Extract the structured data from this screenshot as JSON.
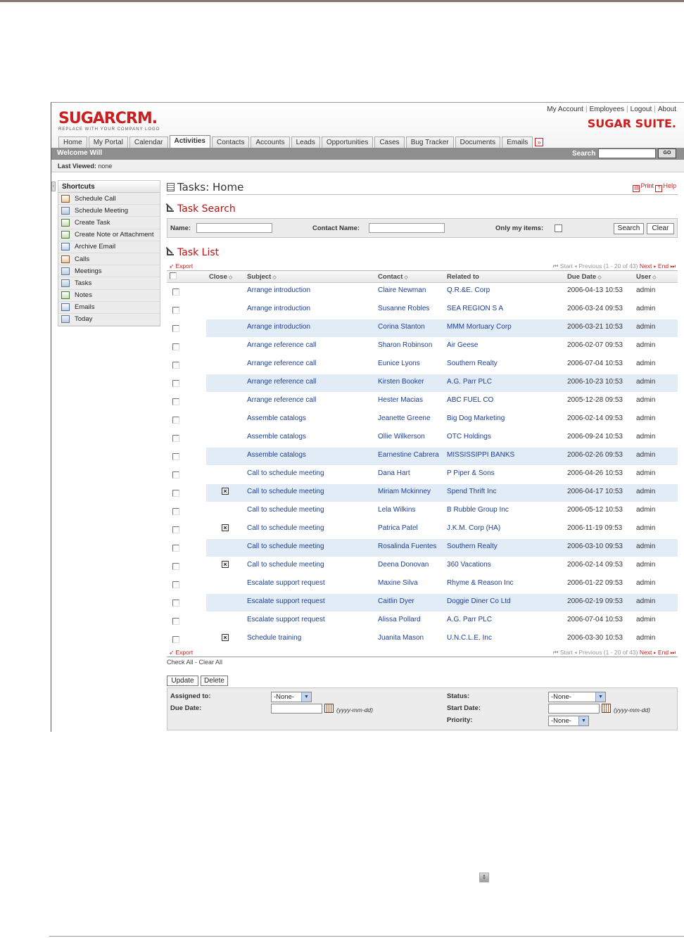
{
  "header": {
    "logo_text": "SUGARCRM.",
    "logo_tagline": "REPLACE WITH YOUR COMPANY LOGO",
    "suite_name": "SUGAR SUITE.",
    "top_links": [
      "My Account",
      "Employees",
      "Logout",
      "About"
    ],
    "tabs": [
      "Home",
      "My Portal",
      "Calendar",
      "Activities",
      "Contacts",
      "Accounts",
      "Leads",
      "Opportunities",
      "Cases",
      "Bug Tracker",
      "Documents",
      "Emails"
    ],
    "active_tab": "Activities",
    "more_tabs_glyph": "»"
  },
  "welcome_bar": {
    "welcome_text": "Welcome Will",
    "search_label": "Search",
    "search_value": "",
    "go_label": "GO"
  },
  "last_viewed": {
    "label": "Last Viewed:",
    "value": "none"
  },
  "shortcuts": {
    "title": "Shortcuts",
    "items": [
      {
        "label": "Schedule Call",
        "icon": "phone-calendar-icon"
      },
      {
        "label": "Schedule Meeting",
        "icon": "meeting-icon"
      },
      {
        "label": "Create Task",
        "icon": "task-icon"
      },
      {
        "label": "Create Note or Attachment",
        "icon": "note-icon"
      },
      {
        "label": "Archive Email",
        "icon": "email-icon"
      },
      {
        "label": "Calls",
        "icon": "calls-icon"
      },
      {
        "label": "Meetings",
        "icon": "meetings-icon"
      },
      {
        "label": "Tasks",
        "icon": "tasks-icon"
      },
      {
        "label": "Notes",
        "icon": "notes-icon"
      },
      {
        "label": "Emails",
        "icon": "emails-icon"
      },
      {
        "label": "Today",
        "icon": "today-icon"
      }
    ]
  },
  "page": {
    "title": "Tasks: Home",
    "print_label": "Print",
    "help_label": "Help"
  },
  "task_search": {
    "heading": "Task Search",
    "name_label": "Name:",
    "name_value": "",
    "contact_name_label": "Contact Name:",
    "contact_name_value": "",
    "only_my_items_label": "Only my items:",
    "search_button": "Search",
    "clear_button": "Clear"
  },
  "task_list": {
    "heading": "Task List",
    "export_label": "Export",
    "pager": {
      "start": "Start",
      "previous": "Previous",
      "range": "(1 - 20 of 43)",
      "next": "Next",
      "end": "End"
    },
    "columns": [
      "Close",
      "Subject",
      "Contact",
      "Related to",
      "Due Date",
      "User"
    ],
    "rows": [
      {
        "closed": false,
        "subject": "Arrange introduction",
        "contact": "Claire Newman",
        "related_to": "Q.R.&E. Corp",
        "due_date": "2006-04-13 10:53",
        "user": "admin"
      },
      {
        "closed": false,
        "subject": "Arrange introduction",
        "contact": "Susanne Robles",
        "related_to": "SEA REGION S A",
        "due_date": "2006-03-24 09:53",
        "user": "admin"
      },
      {
        "closed": false,
        "subject": "Arrange introduction",
        "contact": "Corina Stanton",
        "related_to": "MMM Mortuary Corp",
        "due_date": "2006-03-21 10:53",
        "user": "admin"
      },
      {
        "closed": false,
        "subject": "Arrange reference call",
        "contact": "Sharon Robinson",
        "related_to": "Air Geese",
        "due_date": "2006-02-07 09:53",
        "user": "admin"
      },
      {
        "closed": false,
        "subject": "Arrange reference call",
        "contact": "Eunice Lyons",
        "related_to": "Southern Realty",
        "due_date": "2006-07-04 10:53",
        "user": "admin"
      },
      {
        "closed": false,
        "subject": "Arrange reference call",
        "contact": "Kirsten Booker",
        "related_to": "A.G. Parr PLC",
        "due_date": "2006-10-23 10:53",
        "user": "admin"
      },
      {
        "closed": false,
        "subject": "Arrange reference call",
        "contact": "Hester Macias",
        "related_to": "ABC FUEL CO",
        "due_date": "2005-12-28 09:53",
        "user": "admin"
      },
      {
        "closed": false,
        "subject": "Assemble catalogs",
        "contact": "Jeanette Greene",
        "related_to": "Big Dog Marketing",
        "due_date": "2006-02-14 09:53",
        "user": "admin"
      },
      {
        "closed": false,
        "subject": "Assemble catalogs",
        "contact": "Ollie Wilkerson",
        "related_to": "OTC Holdings",
        "due_date": "2006-09-24 10:53",
        "user": "admin"
      },
      {
        "closed": false,
        "subject": "Assemble catalogs",
        "contact": "Earnestine Cabrera",
        "related_to": "MISSISSIPPI BANKS",
        "due_date": "2006-02-26 09:53",
        "user": "admin"
      },
      {
        "closed": false,
        "subject": "Call to schedule meeting",
        "contact": "Dana Hart",
        "related_to": "P Piper & Sons",
        "due_date": "2006-04-26 10:53",
        "user": "admin"
      },
      {
        "closed": true,
        "subject": "Call to schedule meeting",
        "contact": "Miriam Mckinney",
        "related_to": "Spend Thrift Inc",
        "due_date": "2006-04-17 10:53",
        "user": "admin"
      },
      {
        "closed": false,
        "subject": "Call to schedule meeting",
        "contact": "Lela Wilkins",
        "related_to": "B Rubble Group Inc",
        "due_date": "2006-05-12 10:53",
        "user": "admin"
      },
      {
        "closed": true,
        "subject": "Call to schedule meeting",
        "contact": "Patrica Patel",
        "related_to": "J.K.M. Corp (HA)",
        "due_date": "2006-11-19 09:53",
        "user": "admin"
      },
      {
        "closed": false,
        "subject": "Call to schedule meeting",
        "contact": "Rosalinda Fuentes",
        "related_to": "Southern Realty",
        "due_date": "2006-03-10 09:53",
        "user": "admin"
      },
      {
        "closed": true,
        "subject": "Call to schedule meeting",
        "contact": "Deena Donovan",
        "related_to": "360 Vacations",
        "due_date": "2006-02-14 09:53",
        "user": "admin"
      },
      {
        "closed": false,
        "subject": "Escalate support request",
        "contact": "Maxine Silva",
        "related_to": "Rhyme & Reason Inc",
        "due_date": "2006-01-22 09:53",
        "user": "admin"
      },
      {
        "closed": false,
        "subject": "Escalate support request",
        "contact": "Caitlin Dyer",
        "related_to": "Doggie Diner Co Ltd",
        "due_date": "2006-02-19 09:53",
        "user": "admin"
      },
      {
        "closed": false,
        "subject": "Escalate support request",
        "contact": "Alissa Pollard",
        "related_to": "A.G. Parr PLC",
        "due_date": "2006-07-04 10:53",
        "user": "admin"
      },
      {
        "closed": true,
        "subject": "Schedule training",
        "contact": "Juanita Mason",
        "related_to": "U.N.C.L.E. Inc",
        "due_date": "2006-03-30 10:53",
        "user": "admin"
      }
    ],
    "check_all": "Check All",
    "clear_all": "Clear All",
    "update_button": "Update",
    "delete_button": "Delete"
  },
  "mass_update": {
    "assigned_to_label": "Assigned to:",
    "assigned_to_value": "-None-",
    "due_date_label": "Due Date:",
    "due_date_value": "",
    "date_format_hint": "(yyyy-mm-dd)",
    "status_label": "Status:",
    "status_value": "-None-",
    "start_date_label": "Start Date:",
    "start_date_value": "",
    "priority_label": "Priority:",
    "priority_value": "-None-"
  },
  "colors": {
    "brand_red": "#cc1e1e",
    "link_blue": "#1c3f94",
    "bar_gray": "#8f8f8f",
    "row_alt": "#e2ecf7"
  }
}
